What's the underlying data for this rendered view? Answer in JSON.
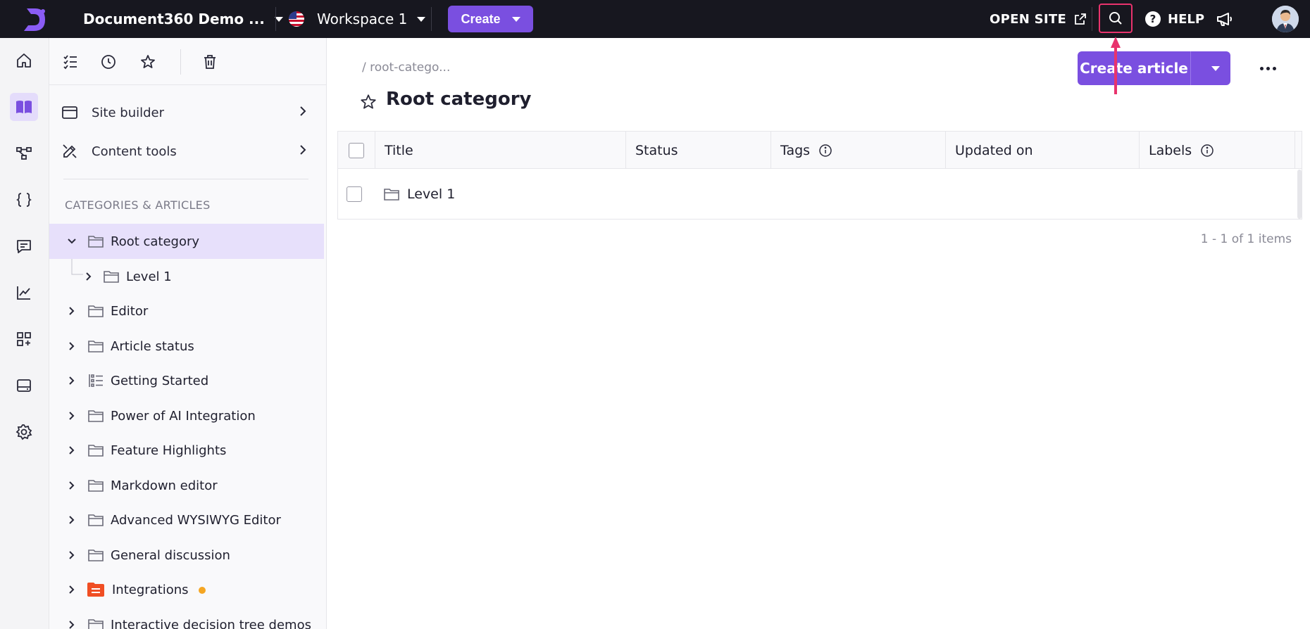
{
  "topbar": {
    "project_name": "Document360 Demo ...",
    "workspace_name": "Workspace 1",
    "create_label": "Create",
    "open_site_label": "OPEN SITE",
    "help_label": "HELP",
    "help_glyph": "?",
    "icons": [
      "logo-icon",
      "us-flag-icon",
      "external-link-icon",
      "search-icon",
      "megaphone-icon",
      "avatar"
    ]
  },
  "rail": {
    "items": [
      "home-icon",
      "knowledge-base-icon",
      "workflow-icon",
      "api-icon",
      "feedback-icon",
      "analytics-icon",
      "apps-icon",
      "widgets-icon",
      "settings-icon"
    ],
    "active": "knowledge-base-icon"
  },
  "sidebar": {
    "tools": [
      "checklist-icon",
      "recent-icon",
      "star-icon",
      "trash-icon"
    ],
    "links": [
      {
        "label": "Site builder",
        "icon": "site-builder-icon"
      },
      {
        "label": "Content tools",
        "icon": "content-tools-icon"
      }
    ],
    "section_heading": "CATEGORIES & ARTICLES",
    "tree": [
      {
        "label": "Root category",
        "expanded": true,
        "selected": true,
        "level": 0
      },
      {
        "label": "Level 1",
        "level": 1
      },
      {
        "label": "Editor",
        "level": 0
      },
      {
        "label": "Article status",
        "level": 0
      },
      {
        "label": "Getting Started",
        "level": 0,
        "icon": "list-category-icon"
      },
      {
        "label": "Power of AI Integration",
        "level": 0
      },
      {
        "label": "Feature Highlights",
        "level": 0
      },
      {
        "label": "Markdown editor",
        "level": 0
      },
      {
        "label": "Advanced WYSIWYG Editor",
        "level": 0
      },
      {
        "label": "General discussion",
        "level": 0
      },
      {
        "label": "Integrations",
        "level": 0,
        "icon": "page-category-icon",
        "badge": "unsaved-dot"
      },
      {
        "label": "Interactive decision tree demos",
        "level": 0
      }
    ]
  },
  "main": {
    "breadcrumb": "/ root-catego...",
    "title": "Root category",
    "create_article_label": "Create article",
    "table": {
      "columns": [
        "Title",
        "Status",
        "Tags",
        "Updated on",
        "Labels"
      ],
      "rows": [
        {
          "title": "Level 1",
          "status": "",
          "tags": "",
          "updated_on": "",
          "labels": ""
        }
      ]
    },
    "pagination": "1 - 1 of 1 items"
  },
  "colors": {
    "topbar_bg": "#17171f",
    "accent": "#7a4fe0",
    "highlight": "#e8336d",
    "selected_row": "#e7e0fb",
    "badge_dot": "#f5a623",
    "integrations_icon": "#f04e23"
  }
}
